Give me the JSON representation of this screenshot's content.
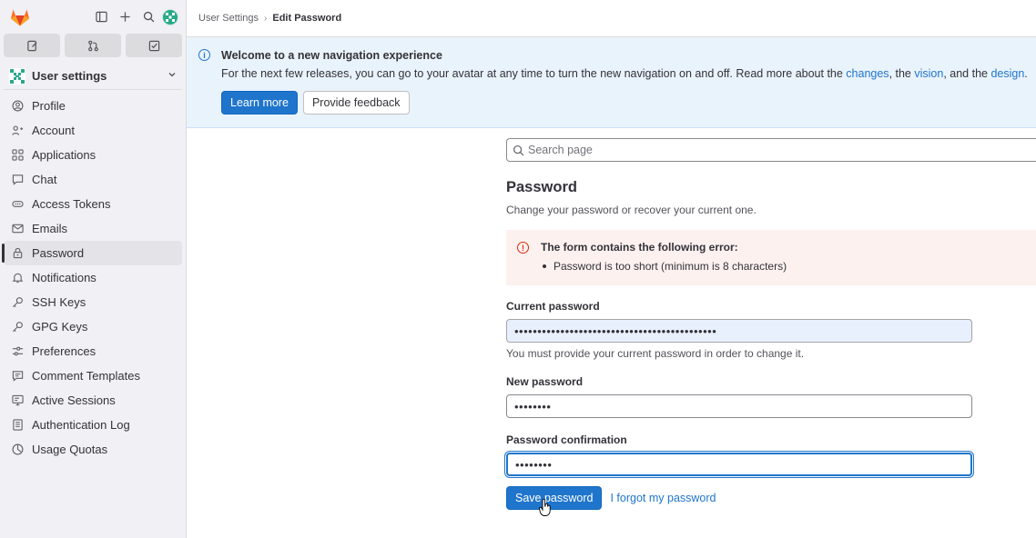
{
  "sidebar": {
    "context_title": "User settings",
    "items": [
      {
        "label": "Profile",
        "icon": "profile-icon"
      },
      {
        "label": "Account",
        "icon": "account-icon"
      },
      {
        "label": "Applications",
        "icon": "applications-icon"
      },
      {
        "label": "Chat",
        "icon": "chat-icon"
      },
      {
        "label": "Access Tokens",
        "icon": "token-icon"
      },
      {
        "label": "Emails",
        "icon": "mail-icon"
      },
      {
        "label": "Password",
        "icon": "lock-icon",
        "active": true
      },
      {
        "label": "Notifications",
        "icon": "bell-icon"
      },
      {
        "label": "SSH Keys",
        "icon": "key-icon"
      },
      {
        "label": "GPG Keys",
        "icon": "key-icon"
      },
      {
        "label": "Preferences",
        "icon": "preferences-icon"
      },
      {
        "label": "Comment Templates",
        "icon": "comment-icon"
      },
      {
        "label": "Active Sessions",
        "icon": "monitor-icon"
      },
      {
        "label": "Authentication Log",
        "icon": "log-icon"
      },
      {
        "label": "Usage Quotas",
        "icon": "quota-icon"
      }
    ]
  },
  "breadcrumb": {
    "parent": "User Settings",
    "current": "Edit Password"
  },
  "banner": {
    "title": "Welcome to a new navigation experience",
    "text_before": "For the next few releases, you can go to your avatar at any time to turn the new navigation on and off. Read more about the ",
    "link_changes": "changes",
    "text_mid1": ", the ",
    "link_vision": "vision",
    "text_mid2": ", and the ",
    "link_design": "design",
    "text_end": ".",
    "learn_more": "Learn more",
    "feedback": "Provide feedback"
  },
  "search": {
    "placeholder": "Search page"
  },
  "page": {
    "title": "Password",
    "description": "Change your password or recover your current one."
  },
  "alert": {
    "title": "The form contains the following error:",
    "errors": [
      "Password is too short (minimum is 8 characters)"
    ]
  },
  "form": {
    "current_label": "Current password",
    "current_value": "••••••••••••••••••••••••••••••••••••••••••••",
    "current_help": "You must provide your current password in order to change it.",
    "new_label": "New password",
    "new_value": "••••••••",
    "confirm_label": "Password confirmation",
    "confirm_value": "••••••••",
    "save": "Save password",
    "forgot": "I forgot my password"
  },
  "colors": {
    "brand": "#1f75cb",
    "danger": "#dd2b0e",
    "sidebar_bg": "#f0f0f5",
    "banner_bg": "#e9f3fc",
    "alert_bg": "#fcf1ef"
  }
}
